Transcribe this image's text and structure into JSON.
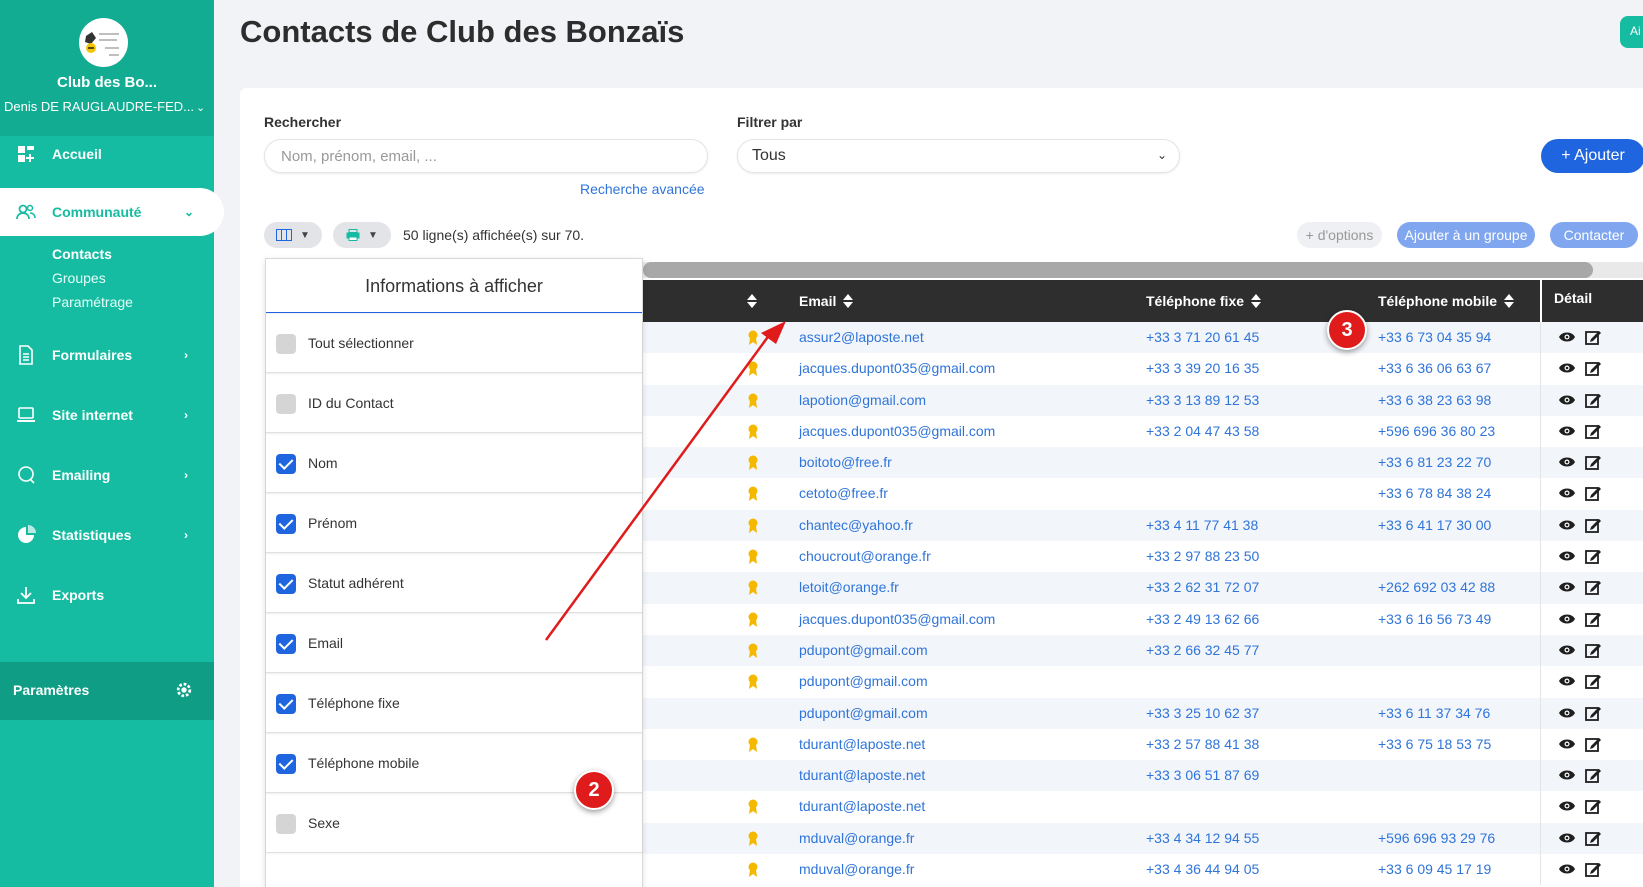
{
  "sidebar": {
    "club_name": "Club des Bo...",
    "user_name": "Denis DE RAUGLAUDRE-FED...",
    "nav": {
      "accueil": "Accueil",
      "communaute": "Communauté",
      "formulaires": "Formulaires",
      "site_internet": "Site internet",
      "emailing": "Emailing",
      "statistiques": "Statistiques",
      "exports": "Exports"
    },
    "sub": {
      "contacts": "Contacts",
      "groupes": "Groupes",
      "parametrage": "Paramétrage"
    },
    "params_label": "Paramètres"
  },
  "header": {
    "title": "Contacts de Club des Bonzaïs",
    "top_button": "Ai"
  },
  "search": {
    "label": "Rechercher",
    "placeholder": "Nom, prénom, email, ...",
    "advanced_link": "Recherche avancée"
  },
  "filter": {
    "label": "Filtrer par",
    "selected": "Tous"
  },
  "actions": {
    "add": "+ Ajouter",
    "rows_info": "50 ligne(s) affichée(s) sur 70.",
    "more_options": "+ d'options",
    "add_to_group": "Ajouter à un groupe",
    "contact": "Contacter"
  },
  "columns_panel": {
    "title": "Informations à afficher",
    "options": [
      {
        "label": "Tout sélectionner",
        "checked": false
      },
      {
        "label": "ID du Contact",
        "checked": false
      },
      {
        "label": "Nom",
        "checked": true
      },
      {
        "label": "Prénom",
        "checked": true
      },
      {
        "label": "Statut adhérent",
        "checked": true
      },
      {
        "label": "Email",
        "checked": true
      },
      {
        "label": "Téléphone fixe",
        "checked": true
      },
      {
        "label": "Téléphone mobile",
        "checked": true
      },
      {
        "label": "Sexe",
        "checked": false
      }
    ]
  },
  "table": {
    "headers": {
      "email": "Email",
      "phone_fixed": "Téléphone fixe",
      "phone_mobile": "Téléphone mobile",
      "detail": "Détail"
    },
    "rows": [
      {
        "badge": true,
        "email": "assur2@laposte.net",
        "fixe": "+33 3 71 20 61 45",
        "mobile": "+33 6 73 04 35 94"
      },
      {
        "badge": true,
        "email": "jacques.dupont035@gmail.com",
        "fixe": "+33 3 39 20 16 35",
        "mobile": "+33 6 36 06 63 67"
      },
      {
        "badge": true,
        "email": "lapotion@gmail.com",
        "fixe": "+33 3 13 89 12 53",
        "mobile": "+33 6 38 23 63 98"
      },
      {
        "badge": true,
        "email": "jacques.dupont035@gmail.com",
        "fixe": "+33 2 04 47 43 58",
        "mobile": "+596 696 36 80 23"
      },
      {
        "badge": true,
        "email": "boitoto@free.fr",
        "fixe": "",
        "mobile": "+33 6 81 23 22 70"
      },
      {
        "badge": true,
        "email": "cetoto@free.fr",
        "fixe": "",
        "mobile": "+33 6 78 84 38 24"
      },
      {
        "badge": true,
        "email": "chantec@yahoo.fr",
        "fixe": "+33 4 11 77 41 38",
        "mobile": "+33 6 41 17 30 00"
      },
      {
        "badge": true,
        "email": "choucrout@orange.fr",
        "fixe": "+33 2 97 88 23 50",
        "mobile": ""
      },
      {
        "badge": true,
        "email": "letoit@orange.fr",
        "fixe": "+33 2 62 31 72 07",
        "mobile": "+262 692 03 42 88"
      },
      {
        "badge": true,
        "email": "jacques.dupont035@gmail.com",
        "fixe": "+33 2 49 13 62 66",
        "mobile": "+33 6 16 56 73 49"
      },
      {
        "badge": true,
        "email": "pdupont@gmail.com",
        "fixe": "+33 2 66 32 45 77",
        "mobile": ""
      },
      {
        "badge": true,
        "email": "pdupont@gmail.com",
        "fixe": "",
        "mobile": ""
      },
      {
        "badge": false,
        "email": "pdupont@gmail.com",
        "fixe": "+33 3 25 10 62 37",
        "mobile": "+33 6 11 37 34 76"
      },
      {
        "badge": true,
        "email": "tdurant@laposte.net",
        "fixe": "+33 2 57 88 41 38",
        "mobile": "+33 6 75 18 53 75"
      },
      {
        "badge": false,
        "email": "tdurant@laposte.net",
        "fixe": "+33 3 06 51 87 69",
        "mobile": ""
      },
      {
        "badge": true,
        "email": "tdurant@laposte.net",
        "fixe": "",
        "mobile": ""
      },
      {
        "badge": true,
        "email": "mduval@orange.fr",
        "fixe": "+33 4 34 12 94 55",
        "mobile": "+596 696 93 29 76"
      },
      {
        "badge": true,
        "email": "mduval@orange.fr",
        "fixe": "+33 4 36 44 94 05",
        "mobile": "+33 6 09 45 17 19"
      }
    ]
  },
  "annotations": {
    "marker_2": "2",
    "marker_3": "3",
    "arrow_color": "#e01b1b"
  },
  "colors": {
    "sidebar": "#16bca1",
    "primary_blue": "#2065e0",
    "link_blue": "#2f74d9",
    "header_dark": "#2e2e2e"
  }
}
